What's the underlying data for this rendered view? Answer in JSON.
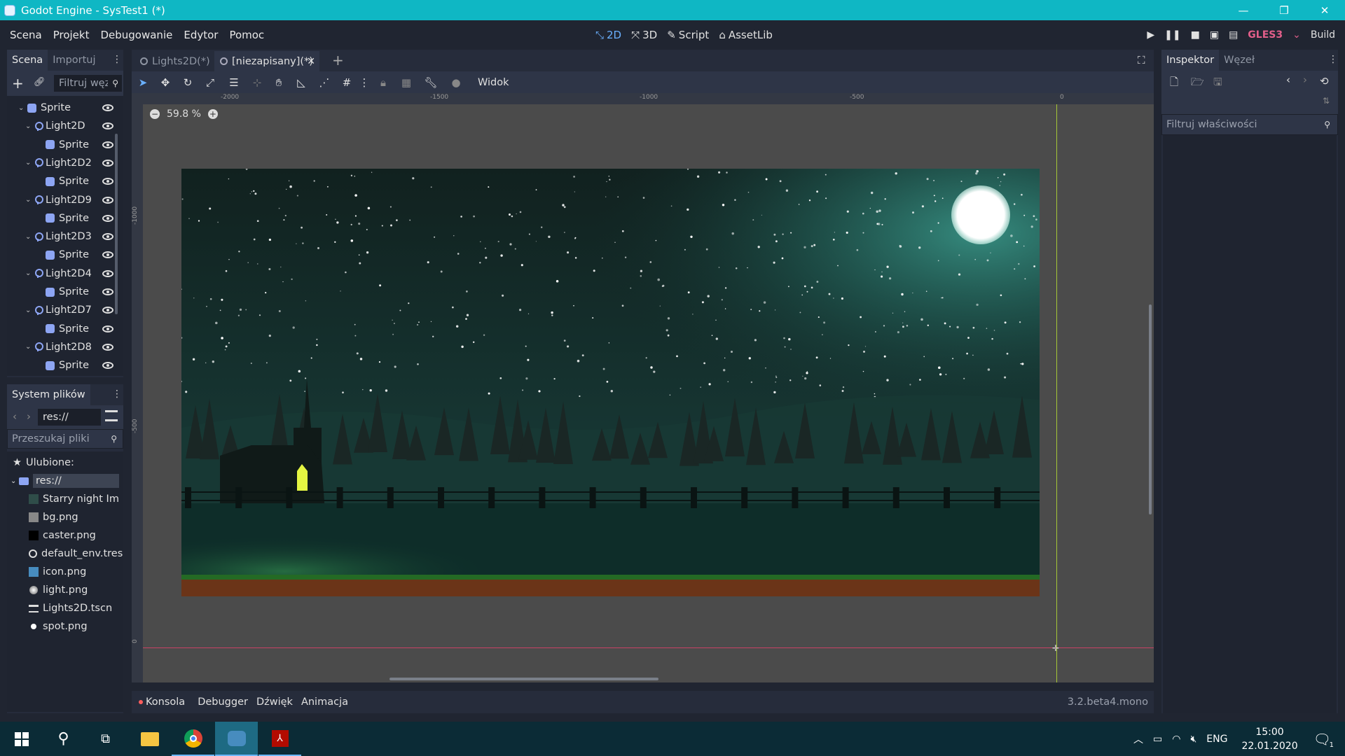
{
  "window": {
    "title": "Godot Engine - SysTest1 (*)"
  },
  "menubar": {
    "items": [
      "Scena",
      "Projekt",
      "Debugowanie",
      "Edytor",
      "Pomoc"
    ],
    "modes": [
      "2D",
      "3D",
      "Script",
      "AssetLib"
    ],
    "renderer": "GLES3",
    "build": "Build"
  },
  "scene_dock": {
    "tabs": [
      "Scena",
      "Importuj"
    ],
    "filter_placeholder": "Filtruj węzły",
    "tree": [
      {
        "label": "Sprite",
        "type": "sprite",
        "level": 0,
        "expanded": true
      },
      {
        "label": "Light2D",
        "type": "light",
        "level": 1,
        "expanded": true
      },
      {
        "label": "Sprite",
        "type": "sprite",
        "level": 2
      },
      {
        "label": "Light2D2",
        "type": "light",
        "level": 1,
        "expanded": true
      },
      {
        "label": "Sprite",
        "type": "sprite",
        "level": 2
      },
      {
        "label": "Light2D9",
        "type": "light",
        "level": 1,
        "expanded": true
      },
      {
        "label": "Sprite",
        "type": "sprite",
        "level": 2
      },
      {
        "label": "Light2D3",
        "type": "light",
        "level": 1,
        "expanded": true
      },
      {
        "label": "Sprite",
        "type": "sprite",
        "level": 2
      },
      {
        "label": "Light2D4",
        "type": "light",
        "level": 1,
        "expanded": true
      },
      {
        "label": "Sprite",
        "type": "sprite",
        "level": 2
      },
      {
        "label": "Light2D7",
        "type": "light",
        "level": 1,
        "expanded": true
      },
      {
        "label": "Sprite",
        "type": "sprite",
        "level": 2
      },
      {
        "label": "Light2D8",
        "type": "light",
        "level": 1,
        "expanded": true
      },
      {
        "label": "Sprite",
        "type": "sprite",
        "level": 2
      }
    ]
  },
  "filesystem_dock": {
    "title": "System plików",
    "path": "res://",
    "search_placeholder": "Przeszukaj pliki",
    "favorites_label": "Ulubione:",
    "root": "res://",
    "files": [
      {
        "name": "Starry night Im",
        "icon": "image-thumb-icon"
      },
      {
        "name": "bg.png",
        "icon": "image-thumb-icon"
      },
      {
        "name": "caster.png",
        "icon": "image-thumb-icon"
      },
      {
        "name": "default_env.tres",
        "icon": "globe-icon"
      },
      {
        "name": "icon.png",
        "icon": "godot-icon"
      },
      {
        "name": "light.png",
        "icon": "dot-icon"
      },
      {
        "name": "Lights2D.tscn",
        "icon": "scene-icon"
      },
      {
        "name": "spot.png",
        "icon": "dot-icon"
      }
    ]
  },
  "editor_tabs": {
    "tabs": [
      "Lights2D(*)",
      "[niezapisany](*)"
    ],
    "view_menu": "Widok"
  },
  "viewport": {
    "zoom": "59.8 %",
    "ruler_top_labels": [
      "-2000",
      "-1500",
      "-1000",
      "-500",
      "0"
    ],
    "ruler_left_labels": [
      "-1000",
      "-500",
      "0"
    ]
  },
  "inspector_dock": {
    "tabs": [
      "Inspektor",
      "Węzeł"
    ],
    "filter_placeholder": "Filtruj właściwości"
  },
  "bottom_panel": {
    "tabs": [
      "Konsola",
      "Debugger",
      "Dźwięk",
      "Animacja"
    ],
    "version": "3.2.beta4.mono"
  },
  "taskbar": {
    "lang": "ENG",
    "time": "15:00",
    "date": "22.01.2020",
    "notifications": "1"
  },
  "colors": {
    "titlebar": "#0fb7c4",
    "accent": "#6ab0ff",
    "gles": "#e25f8a"
  }
}
